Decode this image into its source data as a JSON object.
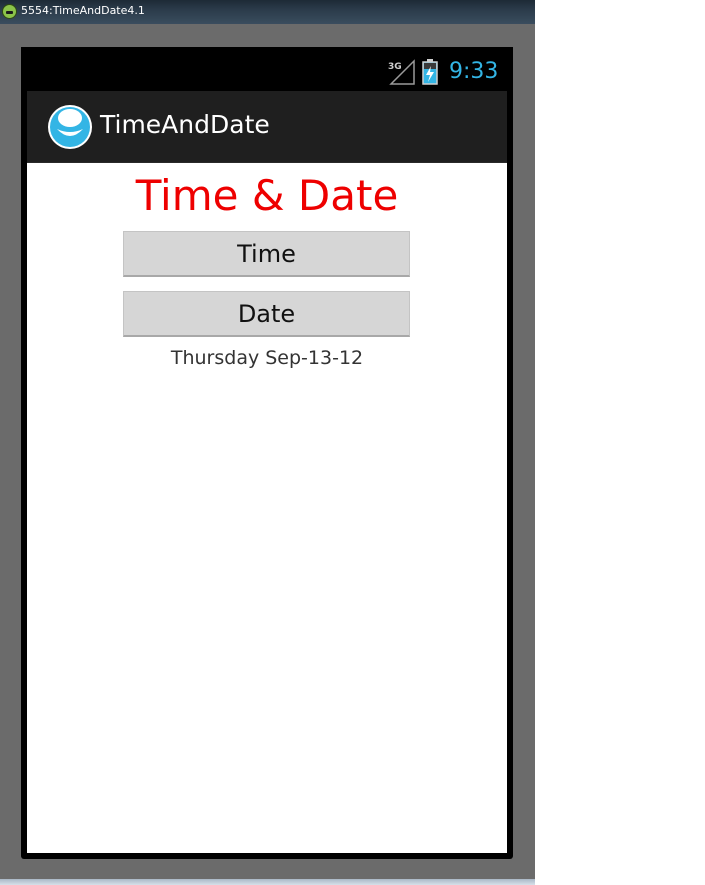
{
  "window": {
    "title": "5554:TimeAndDate4.1"
  },
  "statusbar": {
    "network": "3G",
    "time": "9:33",
    "time_color": "#33b5e5"
  },
  "actionbar": {
    "app_title": "TimeAndDate",
    "icon": "app-face-icon"
  },
  "main": {
    "heading": "Time & Date",
    "heading_color": "#ee0000",
    "time_button_label": "Time",
    "date_button_label": "Date",
    "date_text": "Thursday Sep-13-12"
  }
}
